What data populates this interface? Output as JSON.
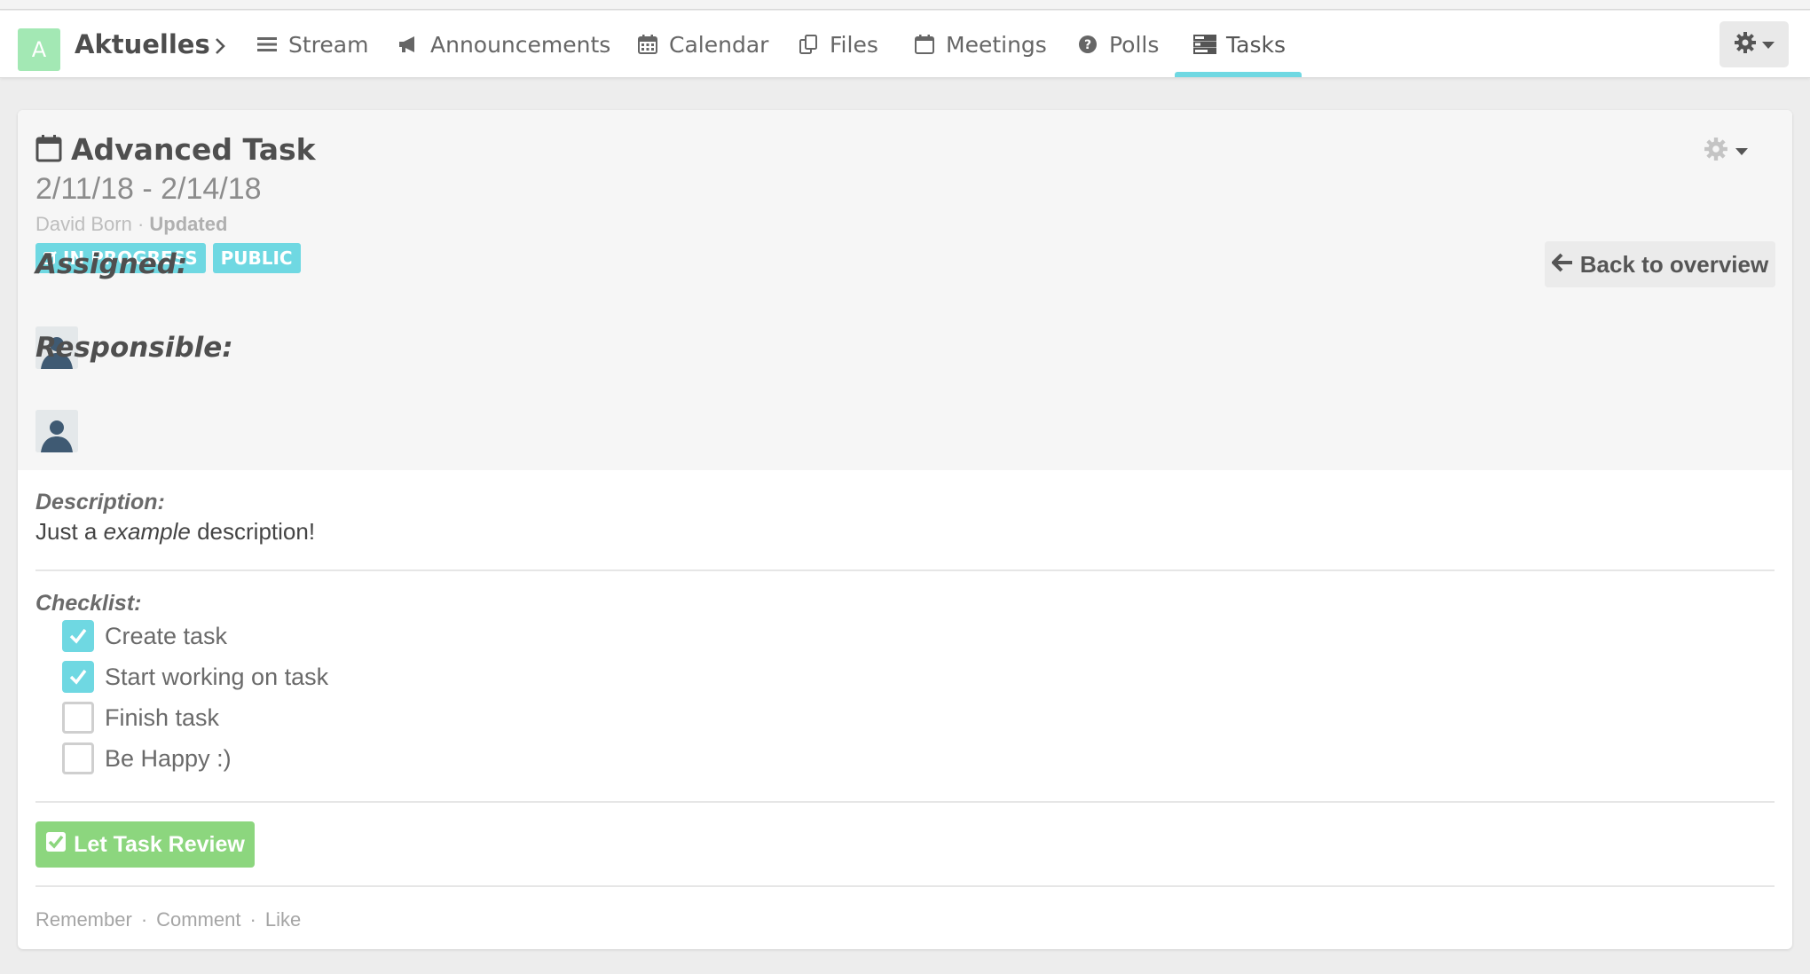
{
  "nav": {
    "space_initial": "A",
    "space_name": "Aktuelles",
    "items": [
      {
        "label": "Stream",
        "icon": "list-icon"
      },
      {
        "label": "Announcements",
        "icon": "bullhorn-icon"
      },
      {
        "label": "Calendar",
        "icon": "calendar-icon"
      },
      {
        "label": "Files",
        "icon": "files-icon"
      },
      {
        "label": "Meetings",
        "icon": "calendar-o-icon"
      },
      {
        "label": "Polls",
        "icon": "question-circle-icon"
      },
      {
        "label": "Tasks",
        "icon": "tasks-icon"
      }
    ],
    "active": "Tasks"
  },
  "task": {
    "title": "Advanced Task",
    "dates": "2/11/18 - 2/14/18",
    "author": "David Born",
    "sep": "·",
    "status_text": "Updated",
    "labels": {
      "status": "IN PROGRESS",
      "visibility": "PUBLIC"
    },
    "assigned_label": "Assigned:",
    "responsible_label": "Responsible:",
    "back_label": "Back to overview",
    "description_label": "Description:",
    "description": {
      "before": "Just a ",
      "emph": "example",
      "after": " description!"
    },
    "checklist_label": "Checklist:",
    "checklist": [
      {
        "label": "Create task",
        "checked": true
      },
      {
        "label": "Start working on task",
        "checked": true
      },
      {
        "label": "Finish task",
        "checked": false
      },
      {
        "label": "Be Happy :)",
        "checked": false
      }
    ],
    "review_button": "Let Task Review",
    "footer": {
      "remember": "Remember",
      "comment": "Comment",
      "like": "Like",
      "dot": "·"
    }
  },
  "colors": {
    "accent": "#6fd8e2",
    "success": "#8cd67e",
    "space_avatar": "#a3e8b4"
  }
}
